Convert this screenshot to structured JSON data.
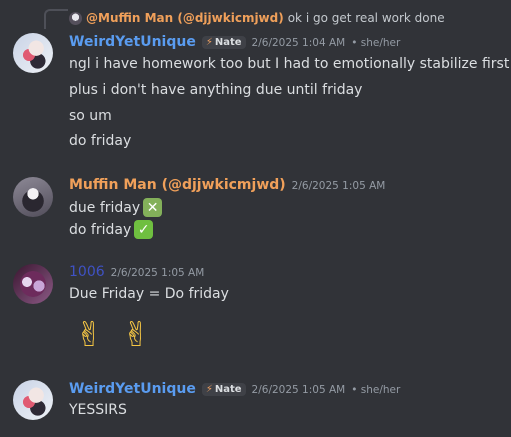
{
  "reply": {
    "author": "@Muffin Man (@djjwkicmjwd)",
    "text": "ok i go get real work done",
    "avatar_icon": "avatar-mini-icon"
  },
  "messages": [
    {
      "author": "WeirdYetUnique",
      "author_color": "#5a9cf0",
      "tag": "Nate",
      "tag_icon": "lightning-icon",
      "timestamp": "2/6/2025 1:04 AM",
      "pronouns": "• she/her",
      "lines": [
        "ngl i have homework too but I had to emotionally stabilize first",
        "plus i don't have anything due until friday",
        "so um",
        "do friday"
      ]
    },
    {
      "author": "Muffin Man (@djjwkicmjwd)",
      "author_color": "#f0a05a",
      "timestamp": "2/6/2025 1:05 AM",
      "lines": [
        "due friday",
        "do friday"
      ],
      "emojis": [
        "cross-mark-emoji",
        "check-mark-emoji"
      ]
    },
    {
      "author": "1006",
      "author_color": "#3f52c4",
      "timestamp": "2/6/2025 1:05 AM",
      "lines": [
        "Due Friday = Do friday"
      ],
      "emojis": [
        "victory-hand-emoji",
        "victory-hand-emoji"
      ]
    },
    {
      "author": "WeirdYetUnique",
      "author_color": "#5a9cf0",
      "tag": "Nate",
      "tag_icon": "lightning-icon",
      "timestamp": "2/6/2025 1:05 AM",
      "pronouns": "• she/her",
      "lines": [
        "YESSIRS"
      ]
    }
  ],
  "glyphs": {
    "lightning": "⚡",
    "cross": "✕",
    "check": "✓",
    "victory": "✌"
  }
}
